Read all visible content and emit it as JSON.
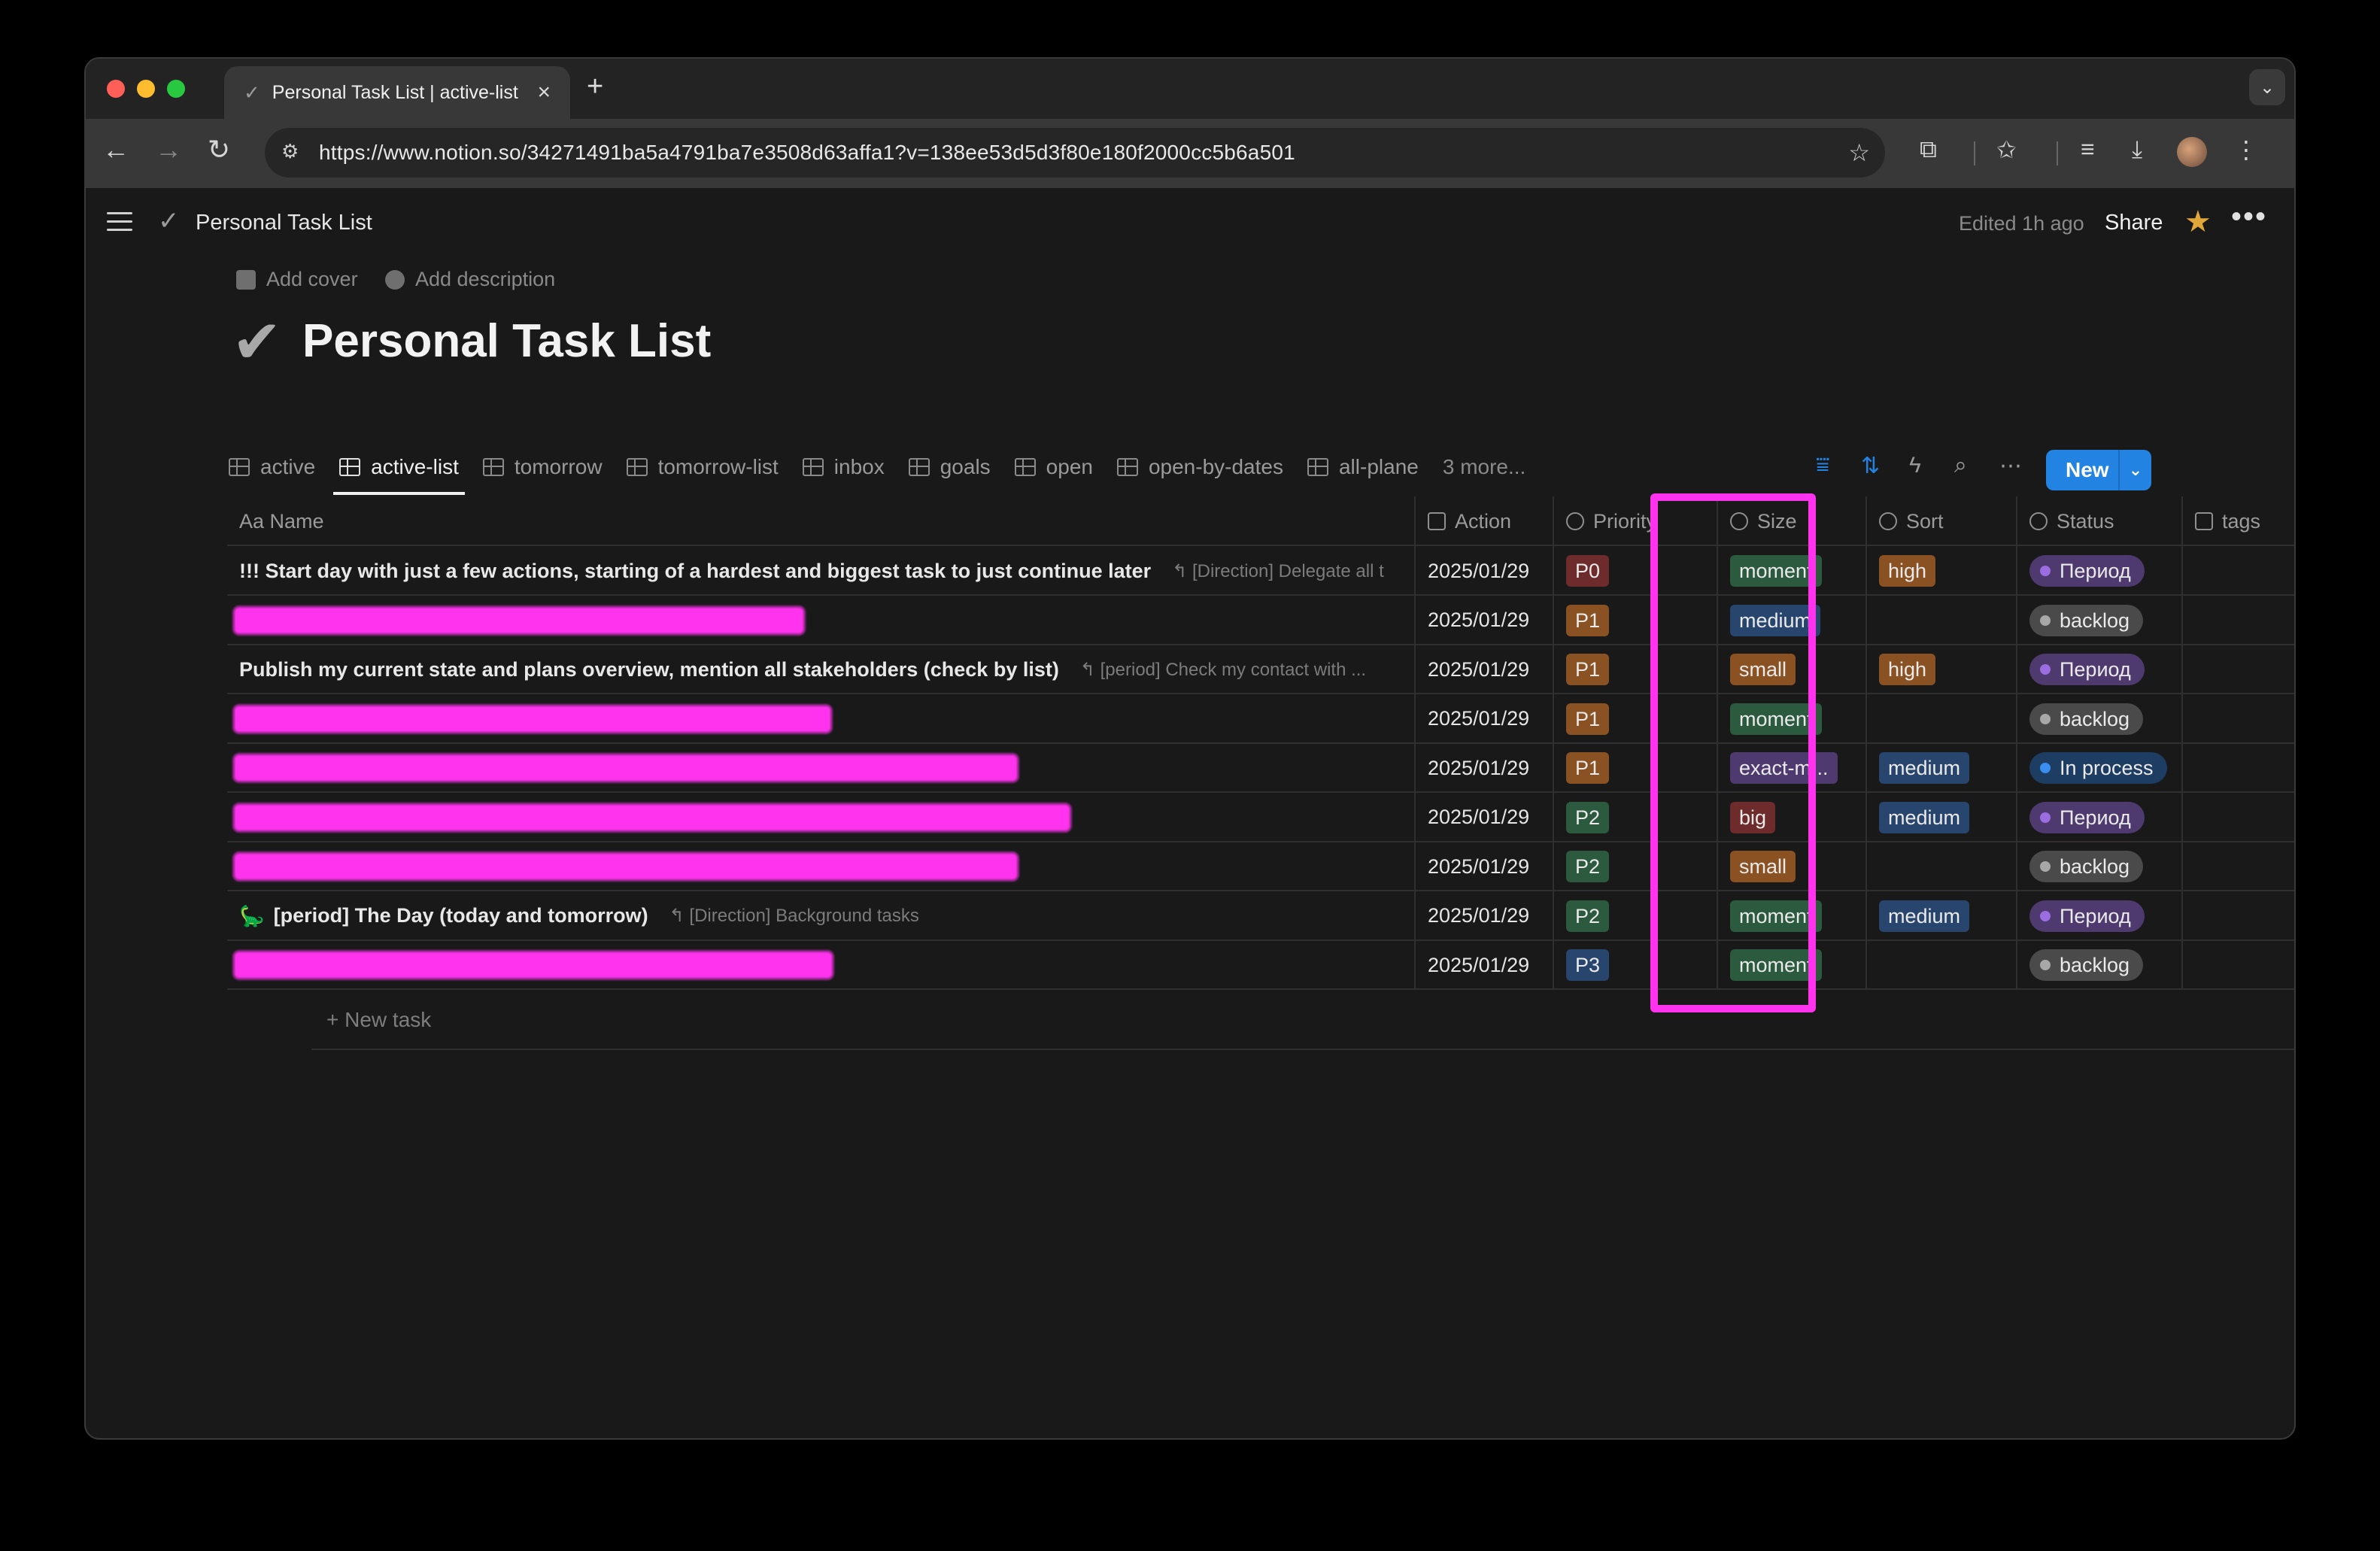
{
  "browser": {
    "tab_title": "Personal Task List | active-list",
    "tab_favicon": "✓",
    "close_glyph": "×",
    "newtab_glyph": "+",
    "url": "https://www.notion.so/34271491ba5a4791ba7e3508d63affa1?v=138ee53d5d3f80e180f2000cc5b6a501",
    "traffic_colors": [
      "#ff5f57",
      "#febc2e",
      "#28c840"
    ]
  },
  "header": {
    "breadcrumb_icon": "✓",
    "breadcrumb": "Personal Task List",
    "edited": "Edited 1h ago",
    "share": "Share",
    "more": "•••"
  },
  "page": {
    "add_cover": "Add cover",
    "add_description": "Add description",
    "icon": "✔",
    "title": "Personal Task List"
  },
  "views": [
    {
      "label": "active"
    },
    {
      "label": "active-list",
      "active": true
    },
    {
      "label": "tomorrow"
    },
    {
      "label": "tomorrow-list"
    },
    {
      "label": "inbox"
    },
    {
      "label": "goals"
    },
    {
      "label": "open"
    },
    {
      "label": "open-by-dates"
    },
    {
      "label": "all-plane"
    }
  ],
  "views_more": "3 more...",
  "new_button": "New",
  "columns": {
    "name": "Aa Name",
    "action": "Action",
    "priority": "Priority",
    "size": "Size",
    "sort": "Sort",
    "status": "Status",
    "tags": "tags"
  },
  "rows": [
    {
      "name": "!!! Start day with just a few actions, starting of a hardest and biggest task to just continue later",
      "relation": "[Direction] Delegate all t",
      "date": "2025/01/29",
      "priority": "P0",
      "size": "moment",
      "sort": "high",
      "status": "Период"
    },
    {
      "name": "",
      "redacted": true,
      "date": "2025/01/29",
      "priority": "P1",
      "size": "medium",
      "sort": "",
      "status": "backlog"
    },
    {
      "name": "Publish my current state and plans overview, mention all stakeholders (check by list)",
      "relation": "[period] Check my contact with ...",
      "date": "2025/01/29",
      "priority": "P1",
      "size": "small",
      "sort": "high",
      "status": "Период"
    },
    {
      "name": "",
      "redacted": true,
      "date": "2025/01/29",
      "priority": "P1",
      "size": "moment",
      "sort": "",
      "status": "backlog"
    },
    {
      "name": "",
      "redacted": true,
      "date": "2025/01/29",
      "priority": "P1",
      "size": "exact-m...",
      "sort": "medium",
      "status": "In process"
    },
    {
      "name": "",
      "redacted": true,
      "date": "2025/01/29",
      "priority": "P2",
      "size": "big",
      "sort": "medium",
      "status": "Период"
    },
    {
      "name": "",
      "redacted": true,
      "date": "2025/01/29",
      "priority": "P2",
      "size": "small",
      "sort": "",
      "status": "backlog"
    },
    {
      "name": "[period] The Day (today and tomorrow)",
      "icon": "🦕",
      "relation": "[Direction] Background tasks",
      "date": "2025/01/29",
      "priority": "P2",
      "size": "moment",
      "sort": "medium",
      "status": "Период"
    },
    {
      "name": "",
      "redacted": true,
      "date": "2025/01/29",
      "priority": "P3",
      "size": "moment",
      "sort": "",
      "status": "backlog"
    }
  ],
  "new_task": "+ New task",
  "colors": {
    "accent": "#2383e2",
    "highlight": "#ff33ee",
    "P0": "#6e2b2b",
    "P1": "#8a5223",
    "P2": "#2b5a3e",
    "P3": "#28456e",
    "moment": "#2b5a3e",
    "medium": "#28456e",
    "small": "#8a5223",
    "exact-m...": "#4e3a6e",
    "big": "#6e2b2b",
    "high": "#8a5223",
    "Период": "#4e3a6e",
    "backlog": "#4a4a4a",
    "In process": "#1e3d63"
  }
}
